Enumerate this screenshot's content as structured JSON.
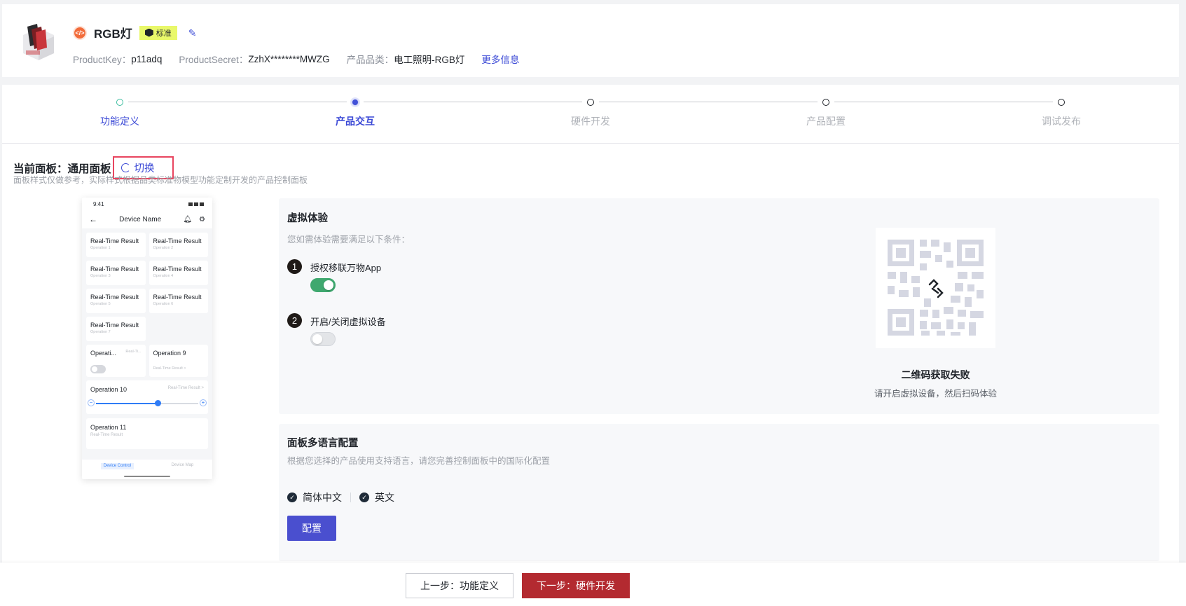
{
  "product": {
    "name": "RGB灯",
    "badge": "标准",
    "product_key_label": "ProductKey：",
    "product_key": "p11adq",
    "product_secret_label": "ProductSecret：",
    "product_secret": "ZzhX********MWZG",
    "category_label": "产品品类：",
    "category": "电工照明-RGB灯",
    "more_info": "更多信息"
  },
  "steps": [
    {
      "label": "功能定义",
      "state": "done"
    },
    {
      "label": "产品交互",
      "state": "active"
    },
    {
      "label": "硬件开发",
      "state": "todo"
    },
    {
      "label": "产品配置",
      "state": "todo"
    },
    {
      "label": "调试发布",
      "state": "todo"
    }
  ],
  "panel": {
    "current_label": "当前面板：",
    "current_value": "通用面板",
    "switch_label": "切换",
    "description": "面板样式仅做参考，实际样式根据品类标准物模型功能定制开发的产品控制面板"
  },
  "phone": {
    "time": "9:41",
    "title": "Device Name",
    "tiles": [
      {
        "title": "Real-Time Result",
        "sub": "Operation 1"
      },
      {
        "title": "Real-Time Result",
        "sub": "Operation 2"
      },
      {
        "title": "Real-Time Result",
        "sub": "Operation 3"
      },
      {
        "title": "Real-Time Result",
        "sub": "Operation 4"
      },
      {
        "title": "Real-Time Result",
        "sub": "Operation 5"
      },
      {
        "title": "Real-Time Result",
        "sub": "Operation 6"
      },
      {
        "title": "Real-Time Result",
        "sub": "Operation 7"
      }
    ],
    "op8_title": "Operati...",
    "op8_sub": "Real-Ti...",
    "op9_title": "Operation 9",
    "op9_sub": "Real-Time Result >",
    "op10_title": "Operation 10",
    "op10_sub": "Real-Time Result >",
    "op10_value": 0.6,
    "op11_title": "Operation 11",
    "op11_sub": "Real-Time Result",
    "tab_control": "Device Control",
    "tab_map": "Device Map"
  },
  "virtual": {
    "title": "虚拟体验",
    "subtitle": "您如需体验需要满足以下条件：",
    "cond1_num": "1",
    "cond1_text": "授权移联万物App",
    "cond1_on": true,
    "cond2_num": "2",
    "cond2_text": "开启/关闭虚拟设备",
    "cond2_on": false,
    "qr_fail_title": "二维码获取失败",
    "qr_fail_sub": "请开启虚拟设备，然后扫码体验"
  },
  "language": {
    "title": "面板多语言配置",
    "subtitle": "根据您选择的产品使用支持语言，请您完善控制面板中的国际化配置",
    "items": [
      "简体中文",
      "英文"
    ],
    "config_button": "配置"
  },
  "footer": {
    "prev": "上一步：功能定义",
    "next": "下一步：硬件开发"
  },
  "colors": {
    "accent": "#3b49d6",
    "primary_button": "#4a4fcf",
    "next_button": "#b32a30",
    "toggle_on": "#3fa86f",
    "highlight_border": "#e8455f"
  }
}
